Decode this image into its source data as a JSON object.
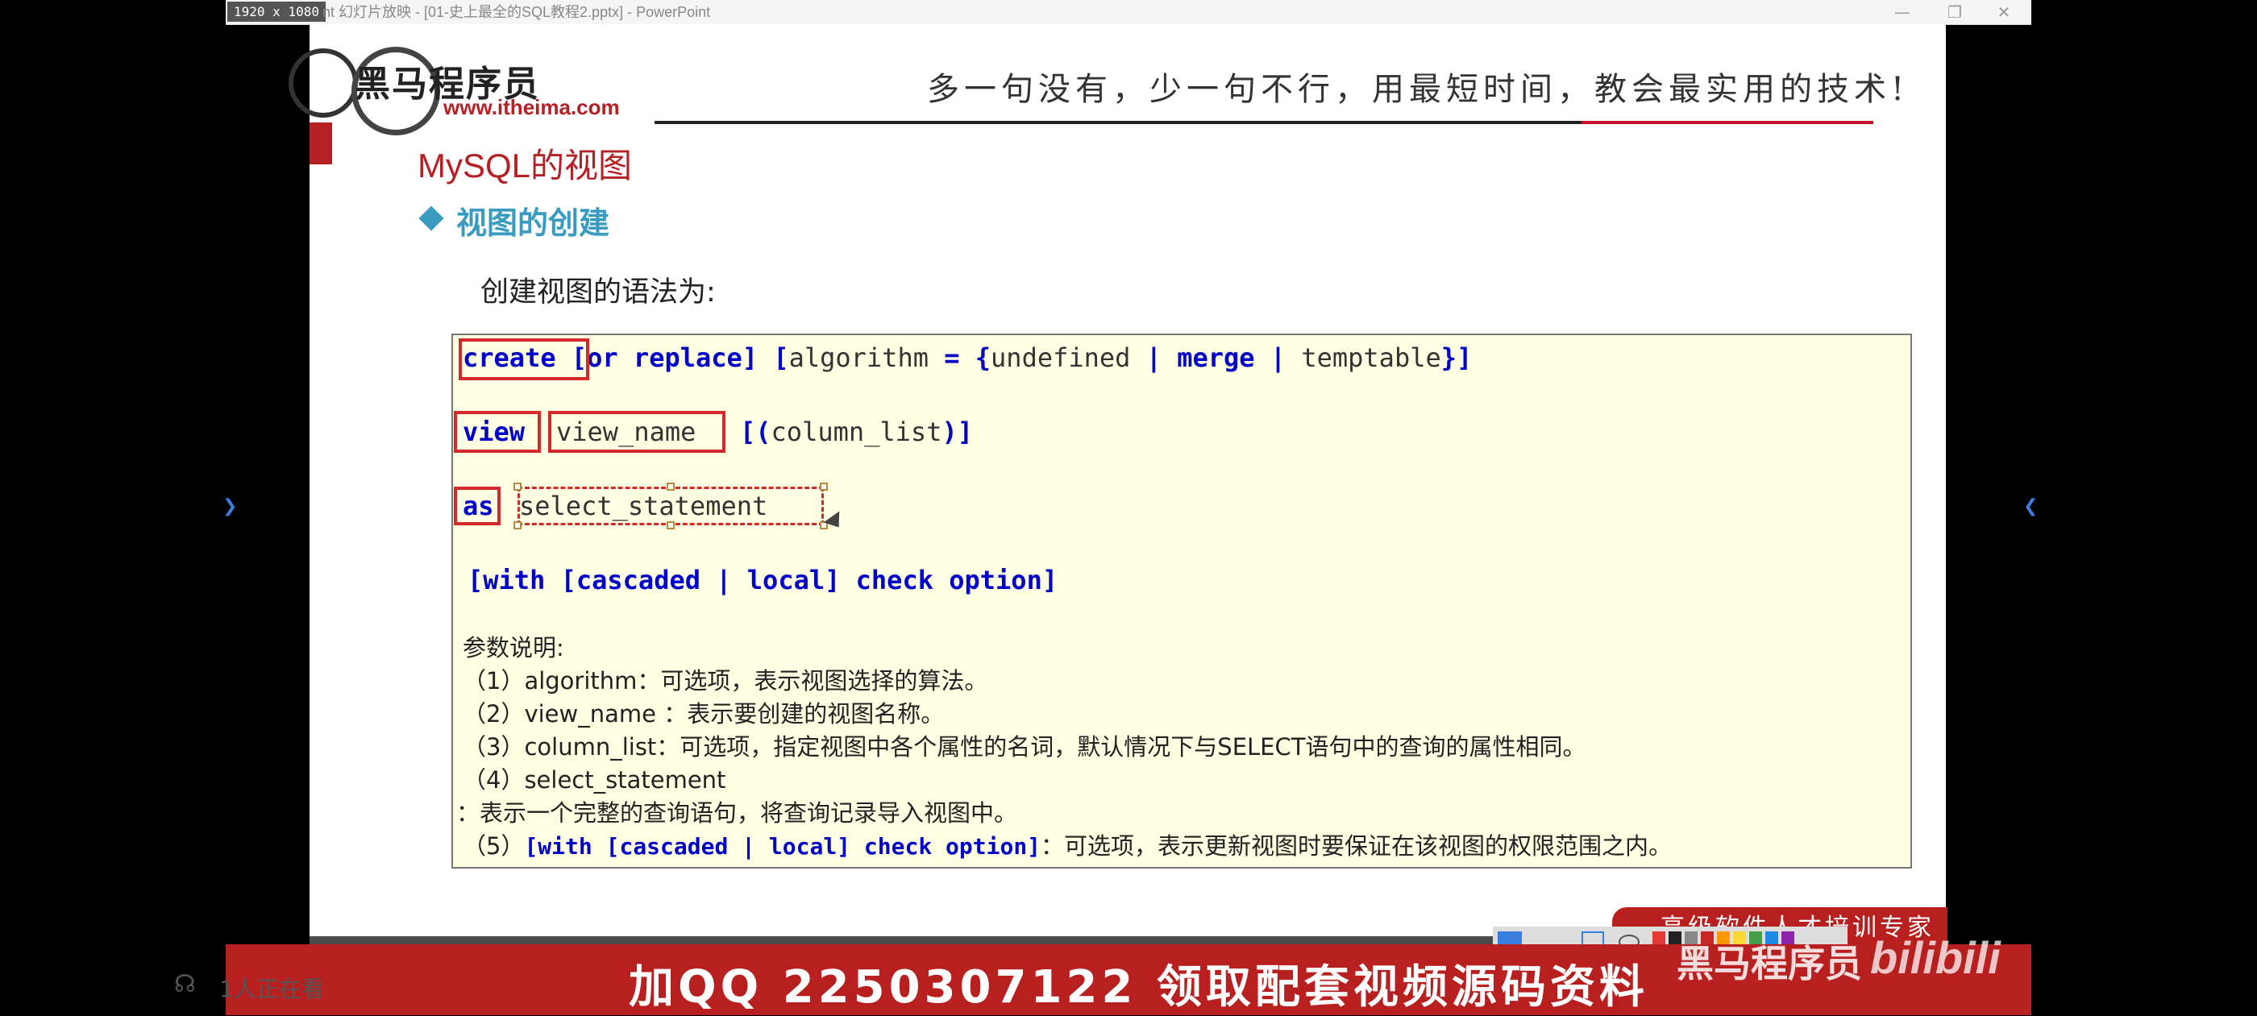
{
  "window": {
    "resolution_badge": "1920 x 1080",
    "title": "nt 幻灯片放映 - [01-史上最全的SQL教程2.pptx] - PowerPoint",
    "minimize": "—",
    "restore": "❐",
    "close": "✕"
  },
  "slide": {
    "logo_text": "黑马程序员",
    "logo_url": "www.itheima.com",
    "slogan": "多一句没有，少一句不行，用最短时间，教会最实用的技术!",
    "title": "MySQL的视图",
    "section_title": "视图的创建",
    "intro": "创建视图的语法为:",
    "code": {
      "line1": {
        "create": "create",
        "rest_kw1": " [or replace] [",
        "algorithm": "algorithm",
        "eq": " = {",
        "undefined": "undefined",
        "pipe1": " | ",
        "merge": "merge",
        "pipe2": " | ",
        "temptable": "temptable",
        "close": "}]"
      },
      "line2": {
        "view": "view",
        "view_name": "view_name",
        "open": "[(",
        "column_list": "column_list",
        "close": ")]"
      },
      "line3": {
        "as": "as",
        "select_statement": "select_statement"
      },
      "line4": "[with [cascaded | local] check option]"
    },
    "params": {
      "heading": "参数说明:",
      "items": [
        "（1）algorithm：可选项，表示视图选择的算法。",
        "（2）view_name ：表示要创建的视图名称。",
        "（3）column_list：可选项，指定视图中各个属性的名词，默认情况下与SELECT语句中的查询的属性相同。",
        "（4）select_statement",
        "：表示一个完整的查询语句，将查询记录导入视图中。"
      ],
      "item5_prefix": "（5）",
      "item5_code": "[with [cascaded | local] check option]",
      "item5_suffix": "：可选项，表示更新视图时要保证在该视图的权限范围之内。"
    },
    "corner_tag": "高级软件人才培训专家"
  },
  "overlay": {
    "banner": "加QQ 2250307122  领取配套视频源码资料",
    "watermark_text": "黑马程序员",
    "watermark_bili": "bilibili",
    "viewers": "1人正在看"
  },
  "colors": {
    "brand_red": "#b52025",
    "section_blue": "#3a9bc1",
    "keyword_blue": "#0000c8",
    "code_bg": "#fefee2",
    "banner_red": "#b82020"
  }
}
